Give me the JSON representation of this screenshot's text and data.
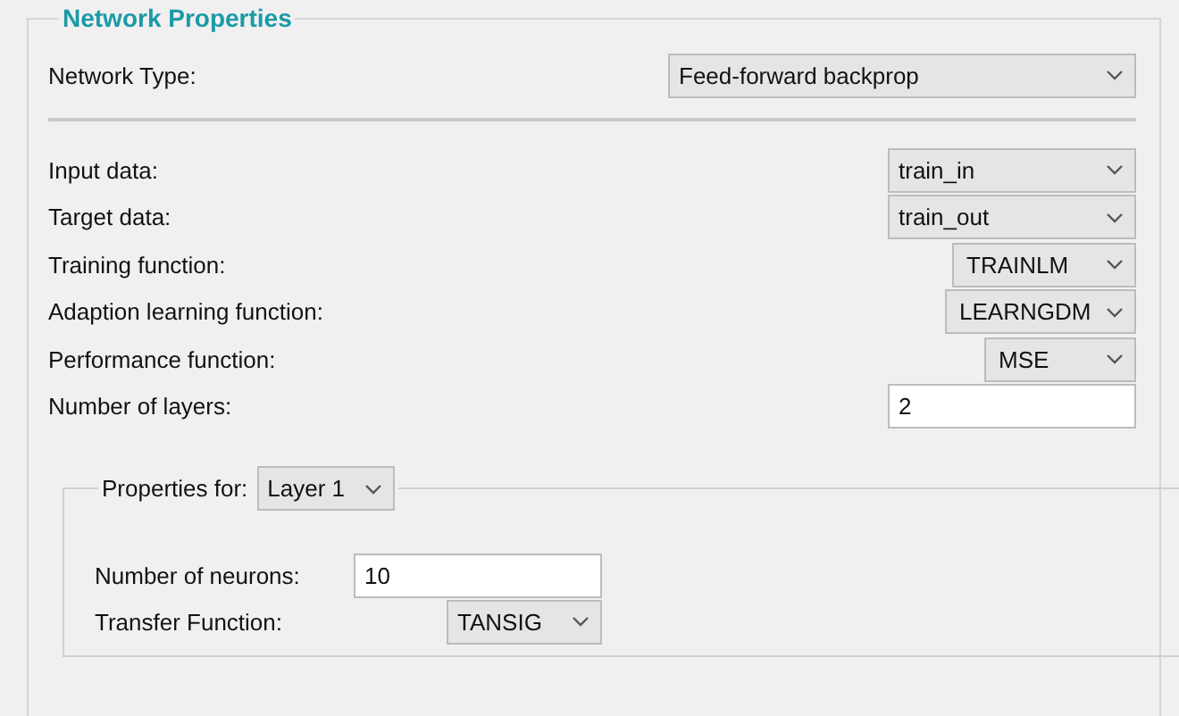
{
  "panel": {
    "title": "Network Properties",
    "network_type": {
      "label": "Network Type:",
      "value": "Feed-forward backprop"
    },
    "rows": [
      {
        "kind": "dropdown",
        "label": "Input data:",
        "value": "train_in"
      },
      {
        "kind": "dropdown",
        "label": "Target data:",
        "value": "train_out"
      },
      {
        "kind": "dropdown",
        "label": "Training function:",
        "value": "TRAINLM"
      },
      {
        "kind": "dropdown",
        "label": "Adaption learning function:",
        "value": "LEARNGDM"
      },
      {
        "kind": "dropdown",
        "label": "Performance function:",
        "value": "MSE"
      },
      {
        "kind": "field",
        "label": "Number of layers:",
        "value": "2"
      }
    ],
    "layer_group": {
      "label": "Properties for:",
      "layer": "Layer 1",
      "rows": [
        {
          "kind": "field",
          "label": "Number of neurons:",
          "value": "10"
        },
        {
          "kind": "dropdown",
          "label": "Transfer Function:",
          "value": "TANSIG"
        }
      ]
    }
  }
}
